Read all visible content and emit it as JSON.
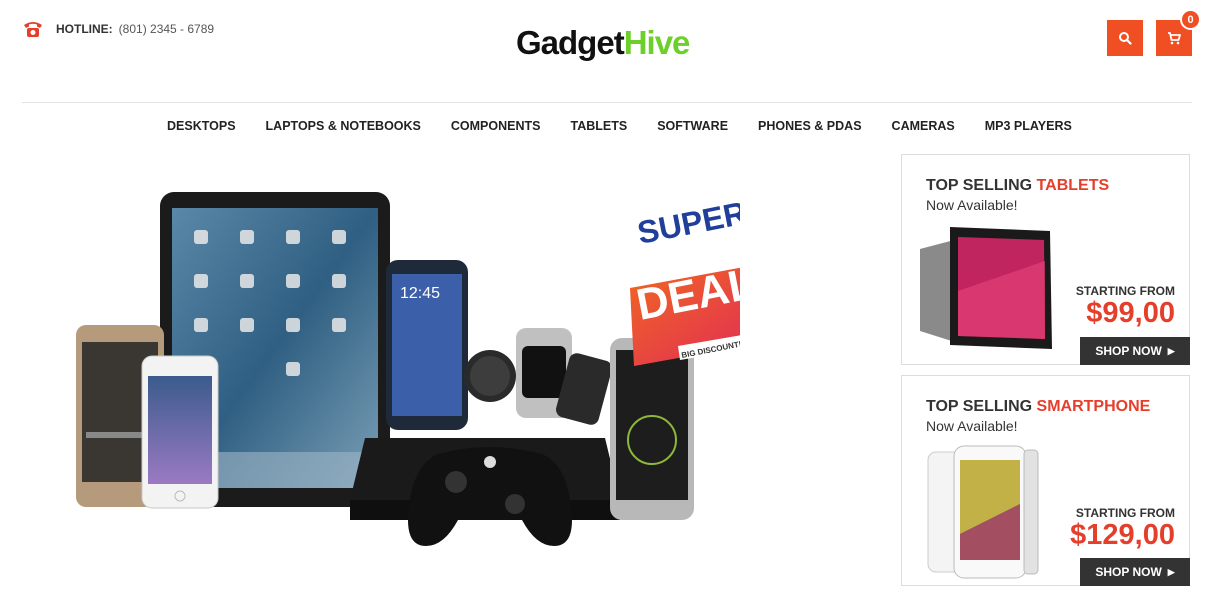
{
  "header": {
    "hotline_label": "HOTLINE:",
    "hotline_number": "(801) 2345 - 6789",
    "logo_part1": "Gadget",
    "logo_part2": "Hive",
    "cart_count": "0",
    "accent_color": "#f04e23"
  },
  "nav": {
    "items": [
      "DESKTOPS",
      "LAPTOPS & NOTEBOOKS",
      "COMPONENTS",
      "TABLETS",
      "SOFTWARE",
      "PHONES & PDAS",
      "CAMERAS",
      "MP3 PLAYERS"
    ]
  },
  "hero": {
    "badge_line1": "SUPER",
    "badge_line2": "DEAL",
    "badge_line3": "BIG DISCOUNT!"
  },
  "promos": [
    {
      "title_prefix": "TOP SELLING ",
      "title_highlight": "TABLETS",
      "subtitle": "Now Available!",
      "starting_label": "STARTING FROM",
      "price": "$99,00",
      "button": "SHOP NOW"
    },
    {
      "title_prefix": "TOP SELLING ",
      "title_highlight": "SMARTPHONE",
      "subtitle": "Now Available!",
      "starting_label": "STARTING FROM",
      "price": "$129,00",
      "button": "SHOP NOW"
    }
  ]
}
